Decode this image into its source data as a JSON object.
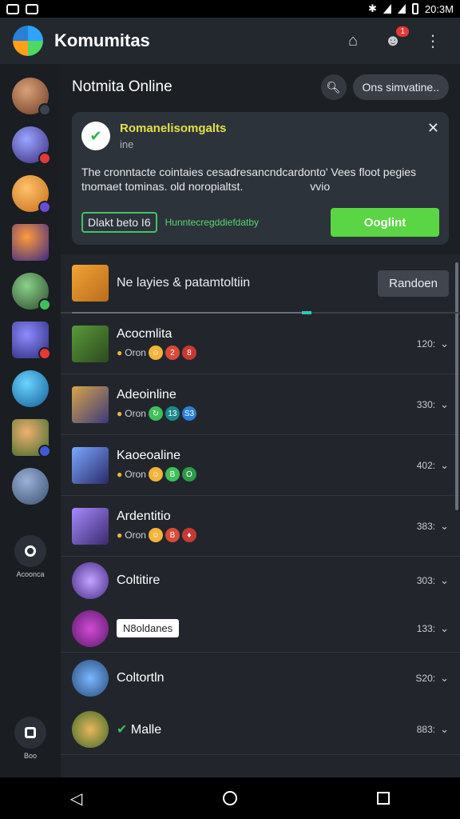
{
  "status": {
    "time": "20:3M"
  },
  "app": {
    "title": "Komumitas"
  },
  "rail": {
    "add_caption": "Acoonca",
    "bottom_caption": "Boo"
  },
  "section": {
    "title": "Notmita Online",
    "filter_label": "Ons simvatine.."
  },
  "banner": {
    "title": "Romanelisomgalts",
    "subtitle": "ine",
    "body": "The cronntacte cointaies cesadresancndcardonto' Vees floot pegies tnomaet tominas. old noropialtst.",
    "body_suffix": "vvio",
    "outline_label": "Dlakt beto I6",
    "link_label": "Hunntecregddiefdatby",
    "primary_label": "Ooglint"
  },
  "list_header": {
    "title": "Ne layies & patamtoltiin",
    "button": "Randoen"
  },
  "rows": [
    {
      "name": "Acocmlita",
      "meta": "Oron",
      "badges": [
        "☺",
        "2",
        "8"
      ],
      "right": "120:"
    },
    {
      "name": "Adeoinline",
      "meta": "Oron",
      "badges": [
        "↻",
        "13",
        "S3"
      ],
      "right": "330:"
    },
    {
      "name": "Kaoeoaline",
      "meta": "Oron",
      "badges": [
        "☺",
        "B",
        "O"
      ],
      "right": "402:"
    },
    {
      "name": "Ardentitio",
      "meta": "Oron",
      "badges": [
        "☺",
        "B",
        "♦"
      ],
      "right": "383:"
    },
    {
      "name": "Coltitire",
      "meta": "",
      "badges": [],
      "right": "303:"
    },
    {
      "name": "",
      "tag": "N8oldanes",
      "right": "133:"
    },
    {
      "name": "Coltortln",
      "meta": "",
      "badges": [],
      "right": "S20:"
    },
    {
      "name": "Malle",
      "check": "✔",
      "right": "883:"
    }
  ],
  "colors": {
    "accent": "#5ad543",
    "banner_title": "#e5e047",
    "link": "#56d66f"
  },
  "icons": {
    "home": "home-icon",
    "profile": "profile-icon",
    "more": "more-icon",
    "search": "search-icon"
  }
}
